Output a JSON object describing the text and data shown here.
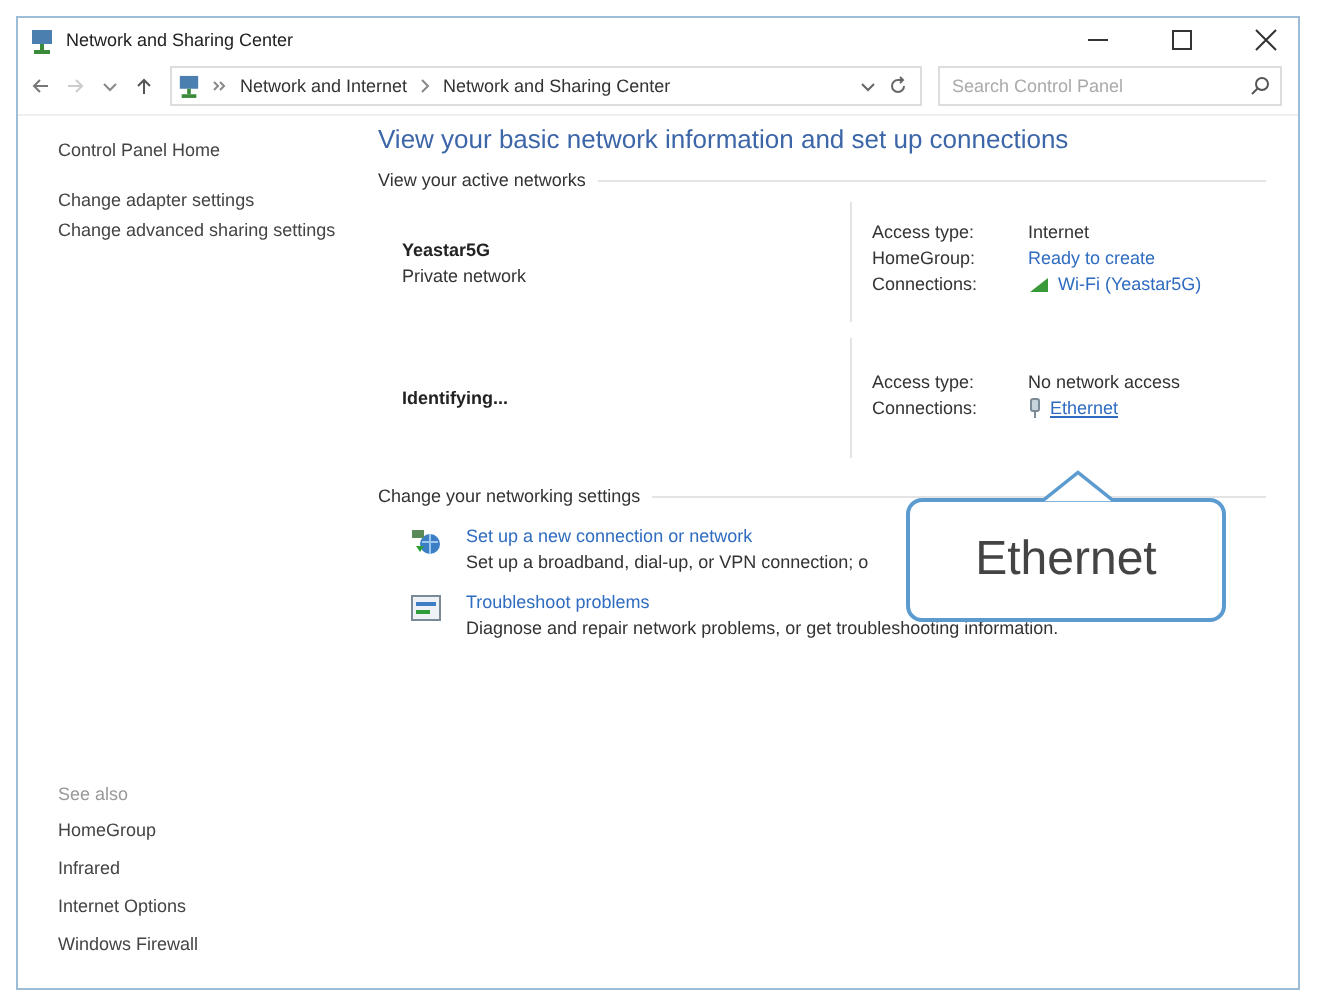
{
  "window": {
    "title": "Network and Sharing Center"
  },
  "address_bar": {
    "breadcrumbs": [
      "Network and Internet",
      "Network and Sharing Center"
    ],
    "search": {
      "placeholder": "Search Control Panel"
    }
  },
  "sidebar": {
    "home": "Control Panel Home",
    "links": [
      "Change adapter settings",
      "Change advanced sharing settings"
    ],
    "see_also": {
      "title": "See also",
      "items": [
        "HomeGroup",
        "Infrared",
        "Internet Options",
        "Windows Firewall"
      ]
    }
  },
  "main": {
    "heading": "View your basic network information and set up connections",
    "active_title": "View your active networks",
    "networks": [
      {
        "name": "Yeastar5G",
        "type": "Private network",
        "details": [
          {
            "label": "Access type:",
            "value": "Internet",
            "kind": "text"
          },
          {
            "label": "HomeGroup:",
            "value": "Ready to create",
            "kind": "link",
            "hovered": false
          },
          {
            "label": "Connections:",
            "value": "Wi-Fi (Yeastar5G)",
            "kind": "wifi-link",
            "hovered": false
          }
        ]
      },
      {
        "name": "Identifying...",
        "details": [
          {
            "label": "Access type:",
            "value": "No network access",
            "kind": "text"
          },
          {
            "label": "Connections:",
            "value": "Ethernet",
            "kind": "ethernet-link",
            "hovered": true
          }
        ]
      }
    ],
    "settings_title": "Change your networking settings",
    "tasks": [
      {
        "kind": "connection",
        "title": "Set up a new connection or network",
        "description": "Set up a broadband, dial-up, or VPN connection; o"
      },
      {
        "kind": "troubleshoot",
        "title": "Troubleshoot problems",
        "description": "Diagnose and repair network problems, or get troubleshooting information."
      }
    ]
  },
  "callout": {
    "text": "Ethernet"
  }
}
